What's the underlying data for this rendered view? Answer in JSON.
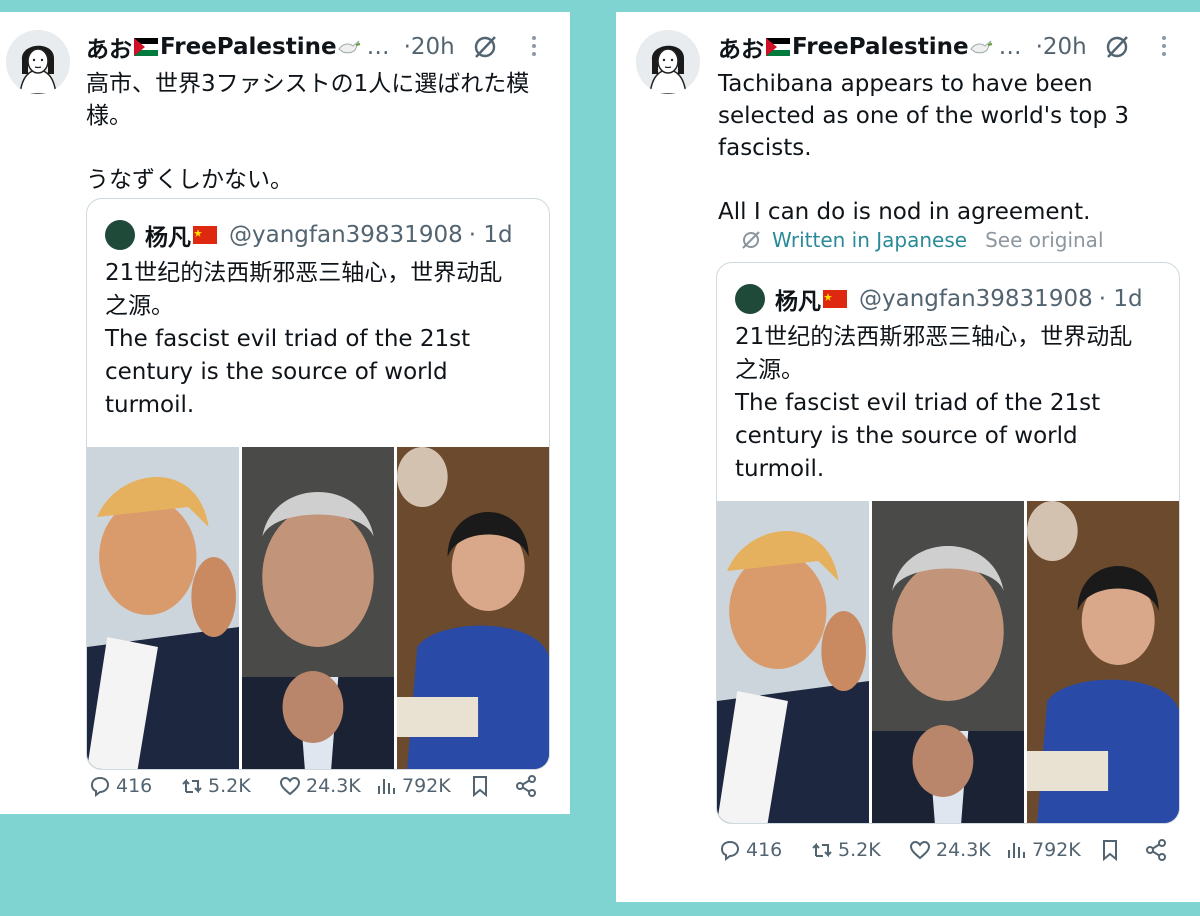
{
  "original_post": {
    "display_name": "あお",
    "name_suffix": "FreePalestine",
    "ellipsis": "…",
    "time": "·20h",
    "text_ja": "高市、世界3ファシストの1人に選ばれた模\n様。\n\nうなずくしかない。",
    "text_en": "Tachibana appears to have been\nselected as one of the world's top 3\nfascists.\n\nAll I can do is nod in agreement.",
    "translation": {
      "written_label": "Written in Japanese",
      "see_original_label": "See original"
    }
  },
  "quoted_post": {
    "display_name": "杨凡",
    "handle": "@yangfan39831908",
    "time": "· 1d",
    "text": "21世纪的法西斯邪恶三轴心，世界动乱\n之源。\nThe fascist evil triad of the 21st\ncentury is the source of world\nturmoil."
  },
  "stats": {
    "replies": "416",
    "reposts": "5.2K",
    "likes": "24.3K",
    "views": "792K"
  },
  "colors": {
    "background": "#7fd3d1",
    "translate_accent": "#2a8a9a",
    "muted": "#536471"
  }
}
